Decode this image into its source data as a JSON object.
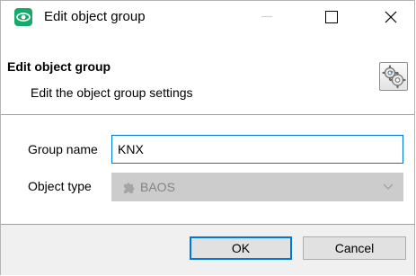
{
  "window": {
    "title": "Edit object group",
    "controls": [
      "minimize",
      "maximize",
      "close"
    ]
  },
  "header": {
    "title": "Edit object group",
    "subtitle": "Edit the object group settings",
    "icon": "gears-icon"
  },
  "form": {
    "group_name_label": "Group name",
    "group_name_value": "KNX",
    "object_type_label": "Object type",
    "object_type_value": "BAOS",
    "object_type_disabled": true
  },
  "footer": {
    "ok_label": "OK",
    "cancel_label": "Cancel"
  },
  "colors": {
    "accent": "#0078d7",
    "app_icon": "#15a96b",
    "footer_bg": "#f0f0f0",
    "disabled_bg": "#cccccc"
  }
}
